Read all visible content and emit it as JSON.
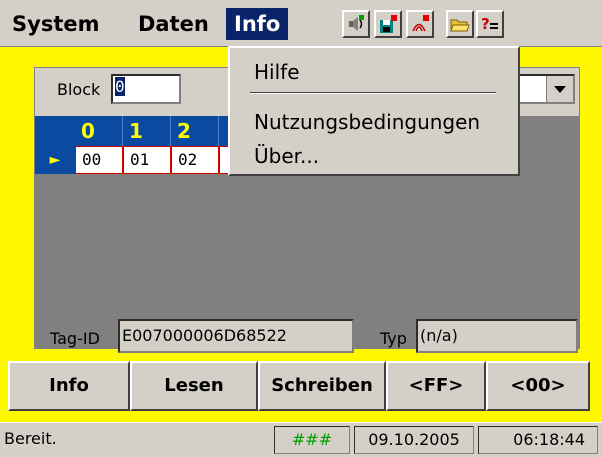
{
  "menubar": {
    "system": "System",
    "daten": "Daten",
    "info": "Info"
  },
  "toolbar_icons": [
    "sound-icon",
    "save-icon",
    "rfid-icon",
    "open-folder-icon",
    "help-icon"
  ],
  "block": {
    "label": "Block",
    "value": "0",
    "selected_option": ""
  },
  "grid": {
    "headers": [
      "0",
      "1",
      "2"
    ],
    "row_marker": "►",
    "cells": [
      "00",
      "01",
      "02"
    ]
  },
  "tag": {
    "label": "Tag-ID",
    "value": "E007000006D68522",
    "typ_label": "Typ",
    "typ_value": "(n/a)"
  },
  "buttons": {
    "info": "Info",
    "lesen": "Lesen",
    "schreiben": "Schreiben",
    "ff": "<FF>",
    "zero": "<00>"
  },
  "status": {
    "text": "Bereit.",
    "indicator": "###",
    "date": "09.10.2005",
    "time": "06:18:44"
  },
  "dropdown_menu": {
    "hilfe": "Hilfe",
    "nutzung": "Nutzungsbedingungen",
    "ueber": "Über..."
  },
  "colors": {
    "yellow_bg": "#fff700",
    "header_blue": "#0a4aa0",
    "header_text": "#ffff00",
    "menu_highlight": "#0a246a",
    "status_green": "#00a000"
  }
}
